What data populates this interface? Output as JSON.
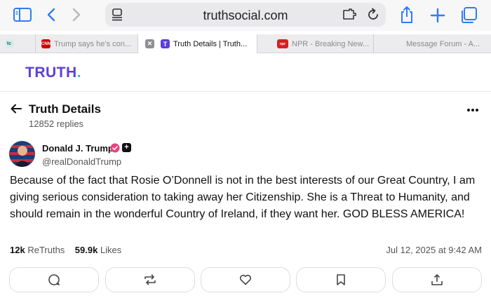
{
  "browser": {
    "url": "truthsocial.com",
    "tabs": [
      {
        "icon": "tc",
        "label": ""
      },
      {
        "icon": "CNN",
        "label": "Trump says he’s con..."
      },
      {
        "icon": "T",
        "label": "Truth Details | Truth..."
      },
      {
        "icon": "npr",
        "label": "NPR - Breaking New..."
      },
      {
        "icon": "",
        "label": "Message Forum - A..."
      }
    ]
  },
  "site": {
    "logo": "TRUTH",
    "logo_dot": "."
  },
  "header": {
    "title": "Truth Details",
    "replies": "12852 replies"
  },
  "post": {
    "author": "Donald J. Trump",
    "handle": "@realDonaldTrump",
    "body": "Because of the fact that Rosie O’Donnell is not in the best interests of our Great Country, I am giving serious consideration to taking away her Citizenship. She is a Threat to Humanity, and should remain in the wonderful Country of Ireland, if they want her. GOD BLESS AMERICA!",
    "retruths_count": "12k",
    "retruths_label": "ReTruths",
    "likes_count": "59.9k",
    "likes_label": "Likes",
    "timestamp": "Jul 12, 2025 at 9:42 AM",
    "plus_badge": "+"
  },
  "colors": {
    "brand": "#5b3fd6",
    "brand_dot": "#2fc8c2",
    "accent_blue": "#2f7cf6",
    "verified": "#e8417c"
  }
}
